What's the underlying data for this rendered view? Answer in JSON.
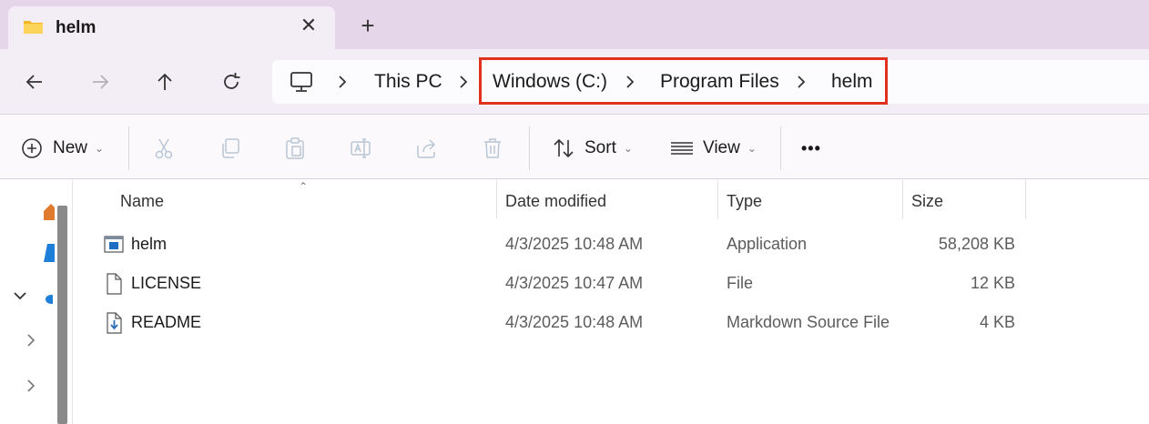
{
  "window": {
    "tab_title": "helm",
    "tab_close": "✕",
    "new_tab": "+"
  },
  "nav": {
    "back": "back",
    "forward": "forward",
    "up": "up",
    "refresh": "refresh"
  },
  "breadcrumb": {
    "items": [
      "This PC",
      "Windows (C:)",
      "Program Files",
      "helm"
    ],
    "separator": "›"
  },
  "toolbar": {
    "new_label": "New",
    "sort_label": "Sort",
    "view_label": "View",
    "more_label": "•••"
  },
  "columns": {
    "name": "Name",
    "date": "Date modified",
    "type": "Type",
    "size": "Size"
  },
  "files": [
    {
      "name": "helm",
      "date": "4/3/2025 10:48 AM",
      "type": "Application",
      "size": "58,208 KB",
      "icon": "application-icon"
    },
    {
      "name": "LICENSE",
      "date": "4/3/2025 10:47 AM",
      "type": "File",
      "size": "12 KB",
      "icon": "file-icon"
    },
    {
      "name": "README",
      "date": "4/3/2025 10:48 AM",
      "type": "Markdown Source File",
      "size": "4 KB",
      "icon": "markdown-file-icon"
    }
  ],
  "colors": {
    "tabstrip": "#e6d6ea",
    "highlight": "#e0301e",
    "accent": "#0067c0"
  }
}
